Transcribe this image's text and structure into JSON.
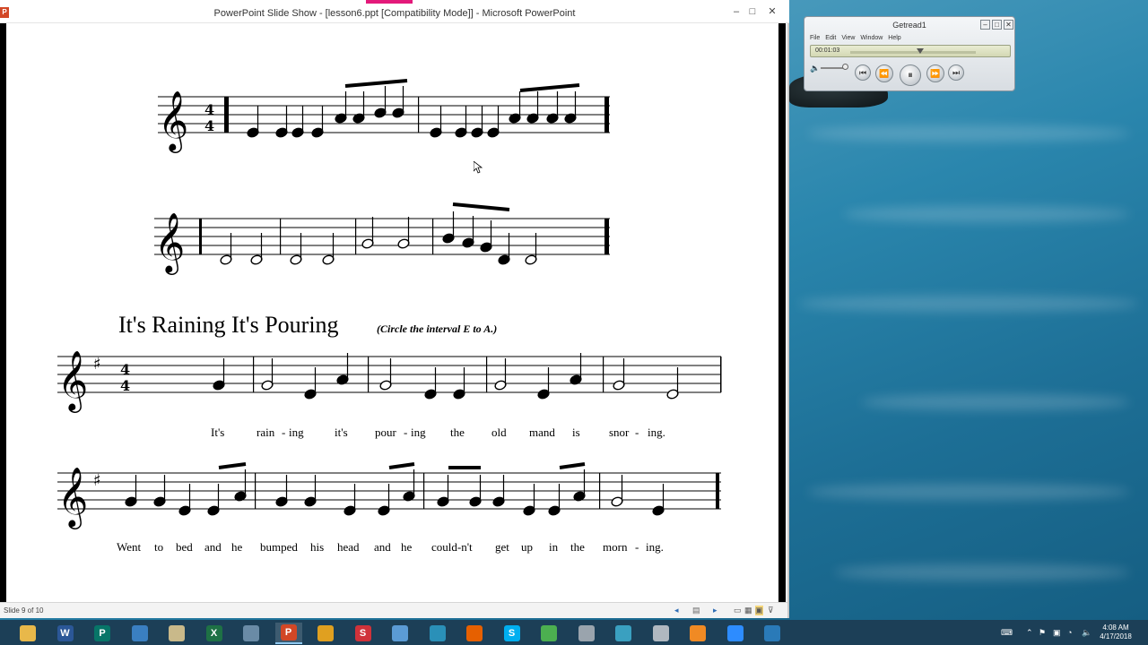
{
  "ppt": {
    "window_title": "PowerPoint Slide Show - [lesson6.ppt [Compatibility Mode]] - Microsoft PowerPoint",
    "app_icon": "P",
    "minimize": "–",
    "maximize": "□",
    "close": "✕",
    "status": {
      "slide_number": "Slide 9 of 10"
    }
  },
  "slide": {
    "song_title": "It's Raining It's Pouring",
    "instruction": "(Circle the interval E to A.)",
    "lyrics_line1": [
      "It's",
      "rain",
      "-",
      "ing",
      "it's",
      "pour",
      "-",
      "ing",
      "the",
      "old",
      "mand",
      "is",
      "snor",
      "-",
      "ing."
    ],
    "lyrics_line2": [
      "Went",
      "to",
      "bed",
      "and",
      "he",
      "bumped",
      "his",
      "head",
      "and",
      "he",
      "could-n't",
      "get",
      "up",
      "in",
      "the",
      "morn",
      "-",
      "ing."
    ]
  },
  "player": {
    "title": "Getread1",
    "menu": [
      "File",
      "Edit",
      "View",
      "Window",
      "Help"
    ],
    "time": "00:01:03",
    "progress": 0.56
  },
  "taskbar": {
    "apps": [
      {
        "name": "file-explorer",
        "glyph": "",
        "color": "#e8b84a"
      },
      {
        "name": "word",
        "glyph": "W",
        "color": "#2b5797"
      },
      {
        "name": "publisher",
        "glyph": "P",
        "color": "#077568"
      },
      {
        "name": "app-4",
        "glyph": "",
        "color": "#3a7fc1"
      },
      {
        "name": "app-5",
        "glyph": "",
        "color": "#c9b98a"
      },
      {
        "name": "excel",
        "glyph": "X",
        "color": "#1e7145"
      },
      {
        "name": "app-7",
        "glyph": "",
        "color": "#6a8ba6"
      },
      {
        "name": "powerpoint",
        "glyph": "P",
        "color": "#d24726"
      },
      {
        "name": "chrome-canary",
        "glyph": "",
        "color": "#e0a020"
      },
      {
        "name": "app-s",
        "glyph": "S",
        "color": "#d0323a"
      },
      {
        "name": "notepad",
        "glyph": "",
        "color": "#5b9bd5"
      },
      {
        "name": "app-12",
        "glyph": "",
        "color": "#2a90b8"
      },
      {
        "name": "firefox",
        "glyph": "",
        "color": "#e66000"
      },
      {
        "name": "skype",
        "glyph": "S",
        "color": "#00aff0"
      },
      {
        "name": "chrome",
        "glyph": "",
        "color": "#4caf50"
      },
      {
        "name": "app-16",
        "glyph": "",
        "color": "#9aa4ad"
      },
      {
        "name": "app-17",
        "glyph": "",
        "color": "#3aa0c0"
      },
      {
        "name": "app-18",
        "glyph": "",
        "color": "#b0b8c0"
      },
      {
        "name": "app-19",
        "glyph": "",
        "color": "#f08a24"
      },
      {
        "name": "zoom",
        "glyph": "",
        "color": "#2d8cff"
      },
      {
        "name": "app-21",
        "glyph": "",
        "color": "#2a7ab8"
      }
    ],
    "clock_time": "4:08 AM",
    "clock_date": "4/17/2018"
  }
}
